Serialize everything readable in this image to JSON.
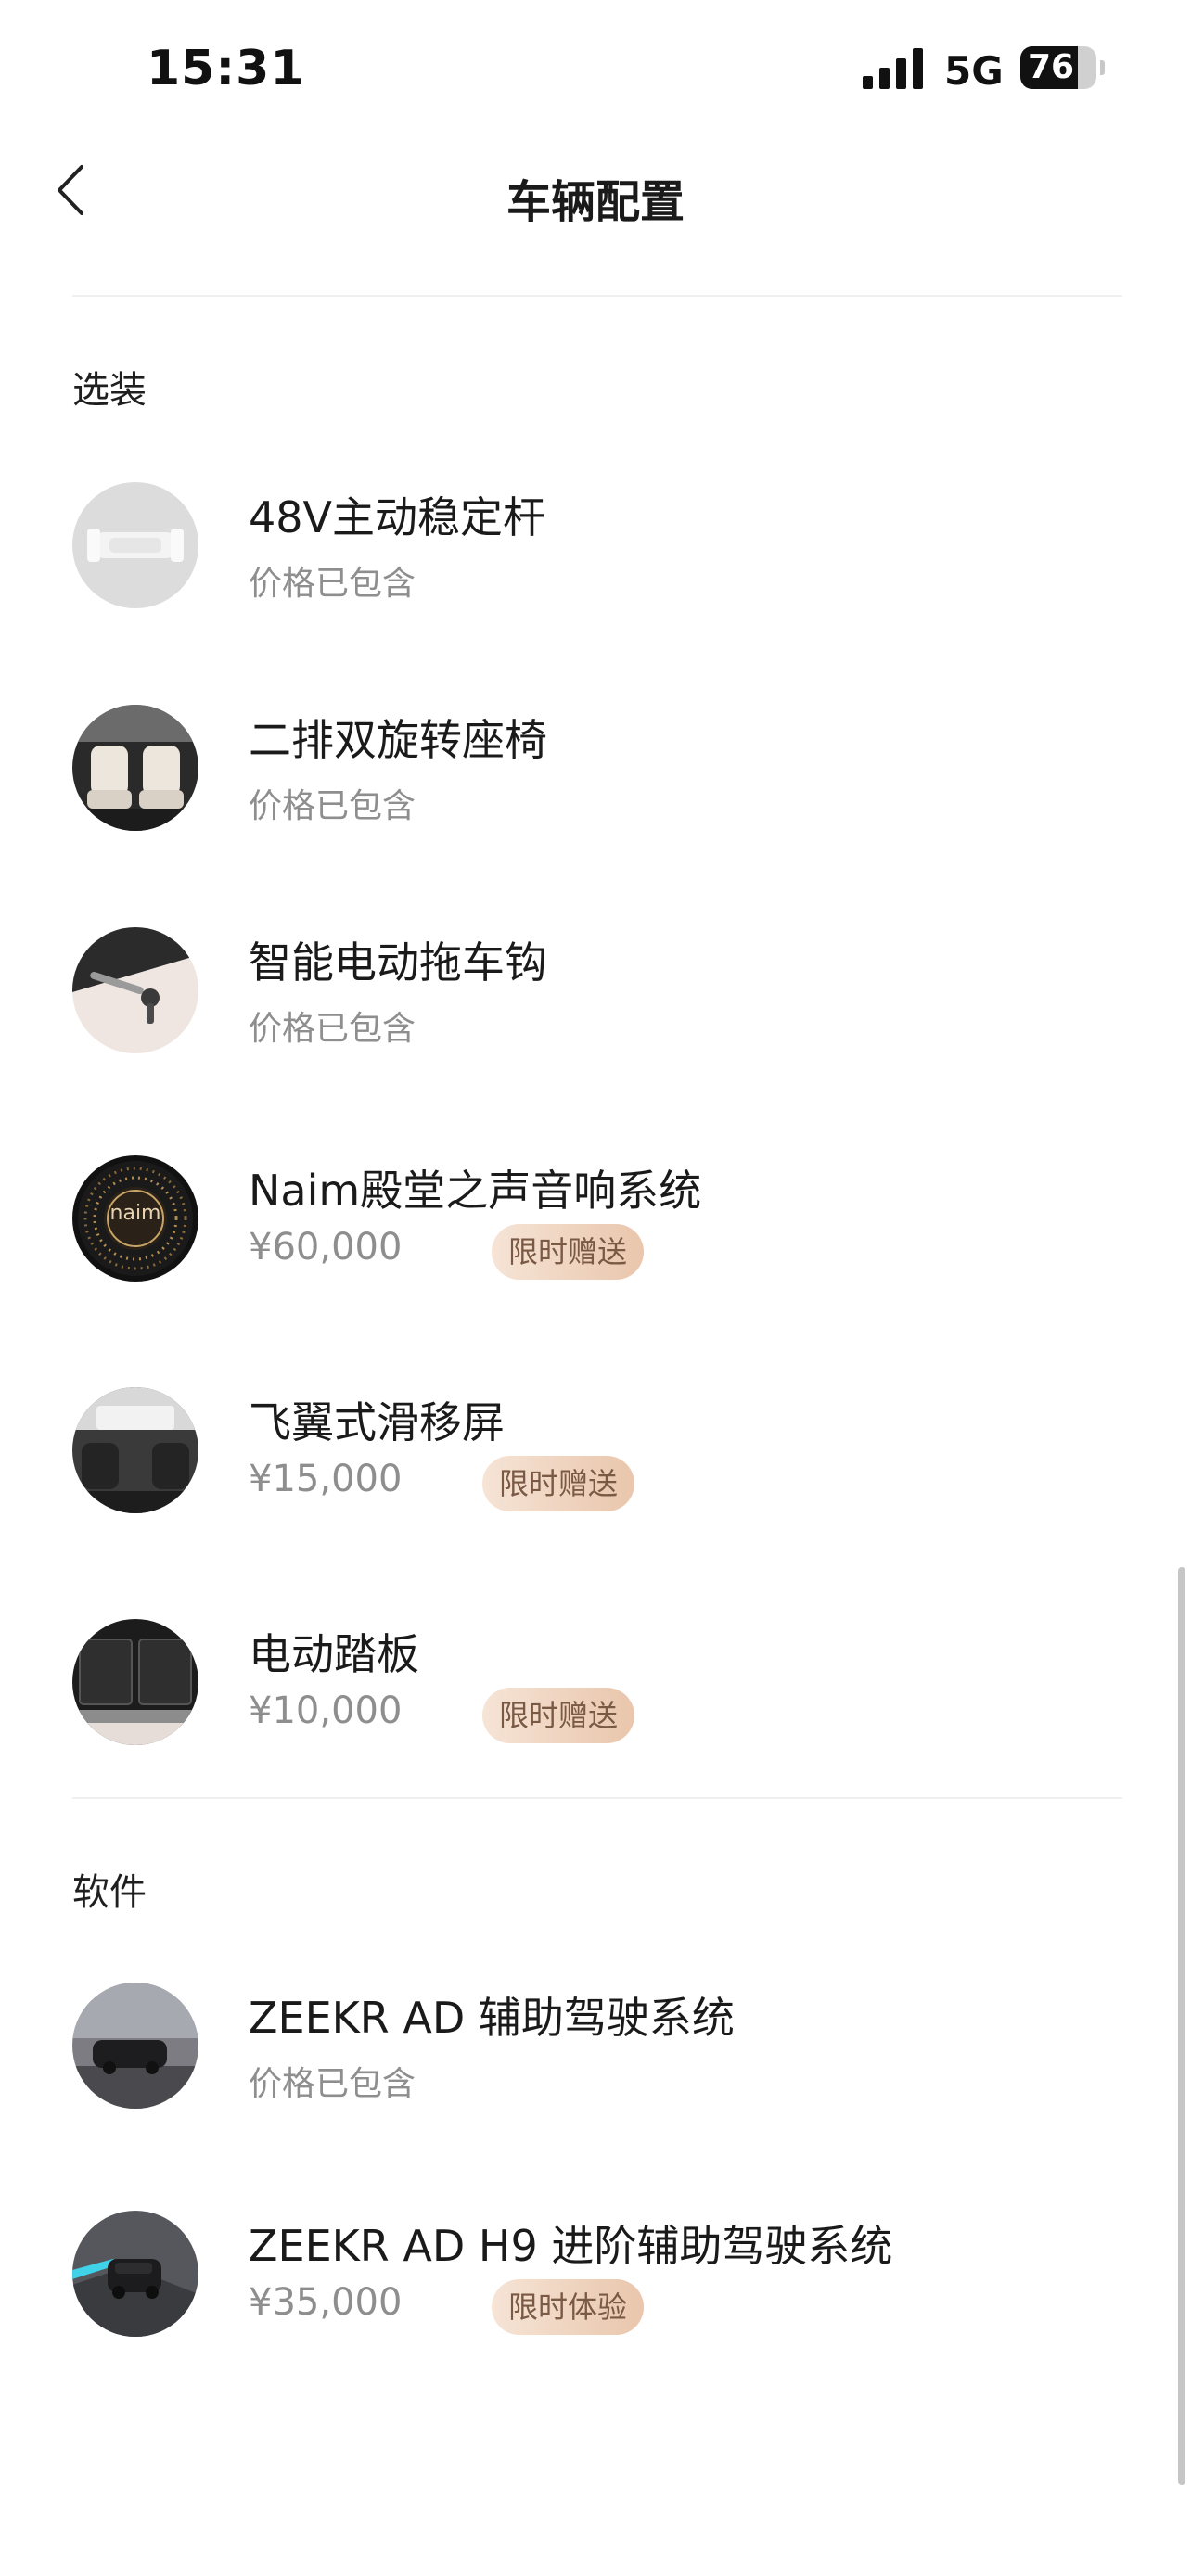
{
  "status_bar": {
    "time": "15:31",
    "network": "5G",
    "battery": "76",
    "battery_level": 0.76
  },
  "header": {
    "title": "车辆配置"
  },
  "sections": {
    "options": {
      "title": "选装",
      "items": [
        {
          "name": "48V主动稳定杆",
          "sub": "价格已包含",
          "image": "stabilizer-bar-image"
        },
        {
          "name": "二排双旋转座椅",
          "sub": "价格已包含",
          "image": "rotating-seats-image"
        },
        {
          "name": "智能电动拖车钩",
          "sub": "价格已包含",
          "image": "tow-hook-image"
        },
        {
          "name": "Naim殿堂之声音响系统",
          "sub": "¥60,000",
          "badge": "限时赠送",
          "image": "naim-speaker-image",
          "logo_text": "naim"
        },
        {
          "name": "飞翼式滑移屏",
          "sub": "¥15,000",
          "badge": "限时赠送",
          "image": "sliding-screen-image"
        },
        {
          "name": "电动踏板",
          "sub": "¥10,000",
          "badge": "限时赠送",
          "image": "power-step-image"
        }
      ]
    },
    "software": {
      "title": "软件",
      "items": [
        {
          "name": "ZEEKR AD 辅助驾驶系统",
          "sub": "价格已包含",
          "image": "driving-assist-image"
        },
        {
          "name": "ZEEKR AD H9 进阶辅助驾驶系统",
          "sub": "¥35,000",
          "badge": "限时体验",
          "image": "advanced-driving-assist-image"
        }
      ]
    }
  },
  "colors": {
    "badge_text": "#7a5a45",
    "badge_bg_start": "#f6e4d6",
    "badge_bg_end": "#e9c6ac",
    "sub_text": "#8e8e8e"
  }
}
